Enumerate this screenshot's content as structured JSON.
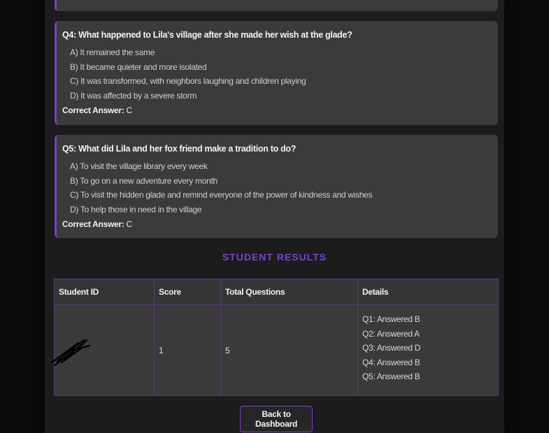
{
  "questions": [
    {
      "text": "Q4: What happened to Lila's village after she made her wish at the glade?",
      "options": [
        "A) It remained the same",
        "B) It became quieter and more isolated",
        "C) It was transformed, with neighbors laughing and children playing",
        "D) It was affected by a severe storm"
      ],
      "answer_label": "Correct Answer:",
      "answer": "C"
    },
    {
      "text": "Q5: What did Lila and her fox friend make a tradition to do?",
      "options": [
        "A) To visit the village library every week",
        "B) To go on a new adventure every month",
        "C) To visit the hidden glade and remind everyone of the power of kindness and wishes",
        "D) To help those in need in the village"
      ],
      "answer_label": "Correct Answer:",
      "answer": "C"
    }
  ],
  "results": {
    "title": "STUDENT RESULTS",
    "columns": [
      "Student ID",
      "Score",
      "Total Questions",
      "Details"
    ],
    "rows": [
      {
        "student_id": "",
        "score": "1",
        "total": "5",
        "details": [
          "Q1: Answered B",
          "Q2: Answered A",
          "Q3: Answered D",
          "Q4: Answered B",
          "Q5: Answered B"
        ]
      }
    ]
  },
  "back_button": "Back to Dashboard",
  "colors": {
    "accent": "#7a3fc0",
    "card": "#3b3b3b",
    "panel": "#1c1c1c"
  }
}
